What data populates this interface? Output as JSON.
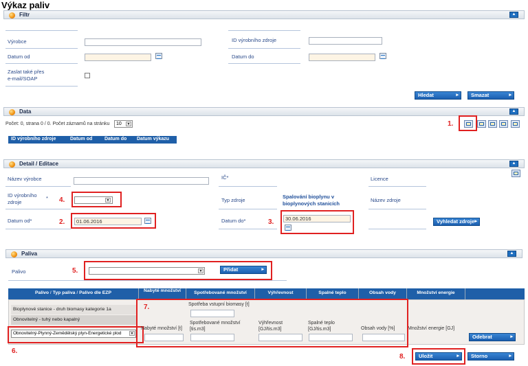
{
  "page_title": "Výkaz paliv",
  "filtr": {
    "header": "Filtr",
    "vyrobce_label": "Výrobce",
    "id_zdroje_label": "ID výrobního zdroje",
    "datum_od_label": "Datum od",
    "datum_do_label": "Datum do",
    "zaslat_label_1": "Zaslat také přes",
    "zaslat_label_2": "e-mail/SOAP",
    "hledat": "Hledat",
    "smazat": "Smazat"
  },
  "data": {
    "header": "Data",
    "pocet_text": "Počet: 0, strana 0 / 0. Počet záznamů na stránku",
    "page_size": "10",
    "columns": [
      "ID výrobního zdroje",
      "Datum od",
      "Datum do",
      "Datum výkazu"
    ]
  },
  "detail": {
    "header": "Detail / Editace",
    "nazev_vyrobce_label": "Název výrobce",
    "ic_label": "IČ",
    "licence_label": "Licence",
    "id_zdroje_label_1": "ID výrobního",
    "id_zdroje_label_2": "zdroje",
    "typ_zdroje_label": "Typ zdroje",
    "typ_zdroje_value_1": "Spalování bioplynu v",
    "typ_zdroje_value_2": "bioplynových stanicích",
    "nazev_zdroje_label": "Název zdroje",
    "datum_od_label": "Datum od",
    "datum_od_value": "01.06.2016",
    "datum_do_label": "Datum do",
    "datum_do_value": "30.06.2016",
    "vyhledat_zdroje": "Vyhledat zdroje",
    "required_mark": "*"
  },
  "paliva": {
    "header": "Paliva",
    "palivo_label": "Palivo",
    "pridat": "Přidat",
    "columns": {
      "palivo_1": "Palivo",
      "palivo_sep1": " / ",
      "palivo_2": "Typ paliva",
      "palivo_sep2": " / ",
      "palivo_3": "Palivo dle EZP",
      "nabyte": "Nabyté množství",
      "spotrebovane": "Spotřebované množství",
      "vyhrevnost": "Výhřevnost",
      "spalne": "Spalné teplo",
      "obsah_vody": "Obsah vody",
      "mnozstvi_energie": "Množství energie"
    },
    "row": {
      "palivo_items": [
        "Bioplynové stanice - druh biomasy kategorie 1a",
        "Obnovitelný - tuhý nebo kapalný"
      ],
      "palivo_select": "Obnovitelný-Plynný-Zemědělský plyn-Energetické plod",
      "spotreba_vstupni_label": "Spotřeba vstupní biomasy [t]",
      "nabyte_label": "Nabyté množství [t]",
      "spotrebovane_label_1": "Spotřebované množství",
      "spotrebovane_label_2": "[tis.m3]",
      "vyhrevnost_label_1": "Výhřevnost",
      "vyhrevnost_label_2": "[GJ/tis.m3]",
      "spalne_label_1": "Spalné teplo",
      "spalne_label_2": "[GJ/tis.m3]",
      "obsah_vody_label": "Obsah vody [%]",
      "mnozstvi_energie_label": "Množství energie [GJ]",
      "odebrat": "Odebrat"
    },
    "ulozit": "Uložit",
    "storno": "Storno"
  },
  "annotations": [
    "1.",
    "2.",
    "3.",
    "4.",
    "5.",
    "6.",
    "7.",
    "8."
  ],
  "colors": {
    "accent_blue": "#1f5fa8",
    "annotation_red": "#e02020",
    "date_bg": "#fdf4e4"
  }
}
